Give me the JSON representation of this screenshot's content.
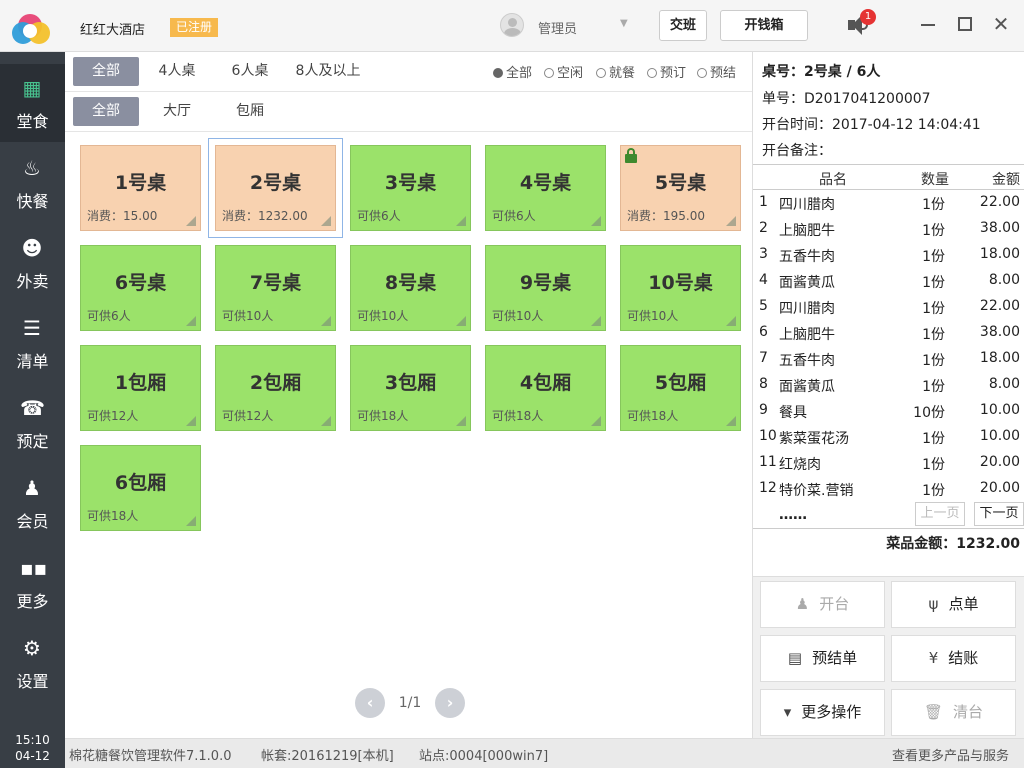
{
  "header": {
    "hotel_name": "红红大酒店",
    "registered_badge": "已注册",
    "admin_name": "管理员",
    "shift_button": "交班",
    "cashbox_button": "开钱箱",
    "notification_count": "1",
    "close_glyph": "✕"
  },
  "sidebar": {
    "items": [
      {
        "label": "堂食",
        "icon": "store-icon",
        "glyph": "▦"
      },
      {
        "label": "快餐",
        "icon": "bell-icon",
        "glyph": "♨"
      },
      {
        "label": "外卖",
        "icon": "courier-icon",
        "glyph": "☻"
      },
      {
        "label": "清单",
        "icon": "clipboard-icon",
        "glyph": "☰"
      },
      {
        "label": "预定",
        "icon": "phone-icon",
        "glyph": "☎"
      },
      {
        "label": "会员",
        "icon": "user-icon",
        "glyph": "♟"
      },
      {
        "label": "更多",
        "icon": "grid-icon",
        "glyph": "▪▪"
      },
      {
        "label": "设置",
        "icon": "gear-icon",
        "glyph": "⚙"
      }
    ],
    "time": "15:10",
    "date": "04-12"
  },
  "filters": {
    "capacity_tabs": [
      "全部",
      "4人桌",
      "6人桌",
      "8人及以上"
    ],
    "status_radios": [
      "全部",
      "空闲",
      "就餐",
      "预订",
      "预结"
    ],
    "area_tabs": [
      "全部",
      "大厅",
      "包厢"
    ]
  },
  "tables": [
    {
      "name": "1号桌",
      "sub": "消费：15.00",
      "state": "orange"
    },
    {
      "name": "2号桌",
      "sub": "消费：1232.00",
      "state": "selected"
    },
    {
      "name": "3号桌",
      "sub": "可供6人",
      "state": "green"
    },
    {
      "name": "4号桌",
      "sub": "可供6人",
      "state": "green"
    },
    {
      "name": "5号桌",
      "sub": "消费：195.00",
      "state": "orange-locked"
    },
    {
      "name": "6号桌",
      "sub": "可供6人",
      "state": "green"
    },
    {
      "name": "7号桌",
      "sub": "可供10人",
      "state": "green"
    },
    {
      "name": "8号桌",
      "sub": "可供10人",
      "state": "green"
    },
    {
      "name": "9号桌",
      "sub": "可供10人",
      "state": "green"
    },
    {
      "name": "10号桌",
      "sub": "可供10人",
      "state": "green"
    },
    {
      "name": "1包厢",
      "sub": "可供12人",
      "state": "green"
    },
    {
      "name": "2包厢",
      "sub": "可供12人",
      "state": "green"
    },
    {
      "name": "3包厢",
      "sub": "可供18人",
      "state": "green"
    },
    {
      "name": "4包厢",
      "sub": "可供18人",
      "state": "green"
    },
    {
      "name": "5包厢",
      "sub": "可供18人",
      "state": "green"
    },
    {
      "name": "6包厢",
      "sub": "可供18人",
      "state": "green"
    }
  ],
  "pager": {
    "text": "1/1",
    "prev": "‹",
    "next": "›"
  },
  "order": {
    "table_line": "桌号：2号桌 / 6人",
    "order_no": "单号：D2017041200007",
    "open_time": "开台时间：2017-04-12 14:04:41",
    "remark": "开台备注：",
    "columns": [
      "品名",
      "数量",
      "金额"
    ],
    "items": [
      {
        "idx": "1",
        "name": "四川腊肉",
        "qty": "1份",
        "amount": "22.00"
      },
      {
        "idx": "2",
        "name": "上脑肥牛",
        "qty": "1份",
        "amount": "38.00"
      },
      {
        "idx": "3",
        "name": "五香牛肉",
        "qty": "1份",
        "amount": "18.00"
      },
      {
        "idx": "4",
        "name": "面酱黄瓜",
        "qty": "1份",
        "amount": "8.00"
      },
      {
        "idx": "5",
        "name": "四川腊肉",
        "qty": "1份",
        "amount": "22.00"
      },
      {
        "idx": "6",
        "name": "上脑肥牛",
        "qty": "1份",
        "amount": "38.00"
      },
      {
        "idx": "7",
        "name": "五香牛肉",
        "qty": "1份",
        "amount": "18.00"
      },
      {
        "idx": "8",
        "name": "面酱黄瓜",
        "qty": "1份",
        "amount": "8.00"
      },
      {
        "idx": "9",
        "name": "餐具",
        "qty": "10份",
        "amount": "10.00"
      },
      {
        "idx": "10",
        "name": "紫菜蛋花汤",
        "qty": "1份",
        "amount": "10.00"
      },
      {
        "idx": "11",
        "name": "红烧肉",
        "qty": "1份",
        "amount": "20.00"
      },
      {
        "idx": "12",
        "name": "特价菜.营销",
        "qty": "1份",
        "amount": "20.00"
      }
    ],
    "more": "……",
    "prev_page": "上一页",
    "next_page": "下一页",
    "total": "菜品金额：1232.00"
  },
  "actions": [
    {
      "label": "开台",
      "icon": "person-icon",
      "glyph": "♟",
      "enabled": false
    },
    {
      "label": "点单",
      "icon": "utensils-icon",
      "glyph": "ψ",
      "enabled": true
    },
    {
      "label": "预结单",
      "icon": "printer-icon",
      "glyph": "▤",
      "enabled": true
    },
    {
      "label": "结账",
      "icon": "yen-icon",
      "glyph": "¥",
      "enabled": true
    },
    {
      "label": "更多操作",
      "icon": "caret-down-icon",
      "glyph": "▾",
      "enabled": true
    },
    {
      "label": "清台",
      "icon": "trash-icon",
      "glyph": "🗑",
      "enabled": false
    }
  ],
  "footer": {
    "software": "棉花糖餐饮管理软件7.1.0.0",
    "account": "帐套:20161219[本机]",
    "station": "站点:0004[000win7]",
    "more_link": "查看更多产品与服务"
  }
}
